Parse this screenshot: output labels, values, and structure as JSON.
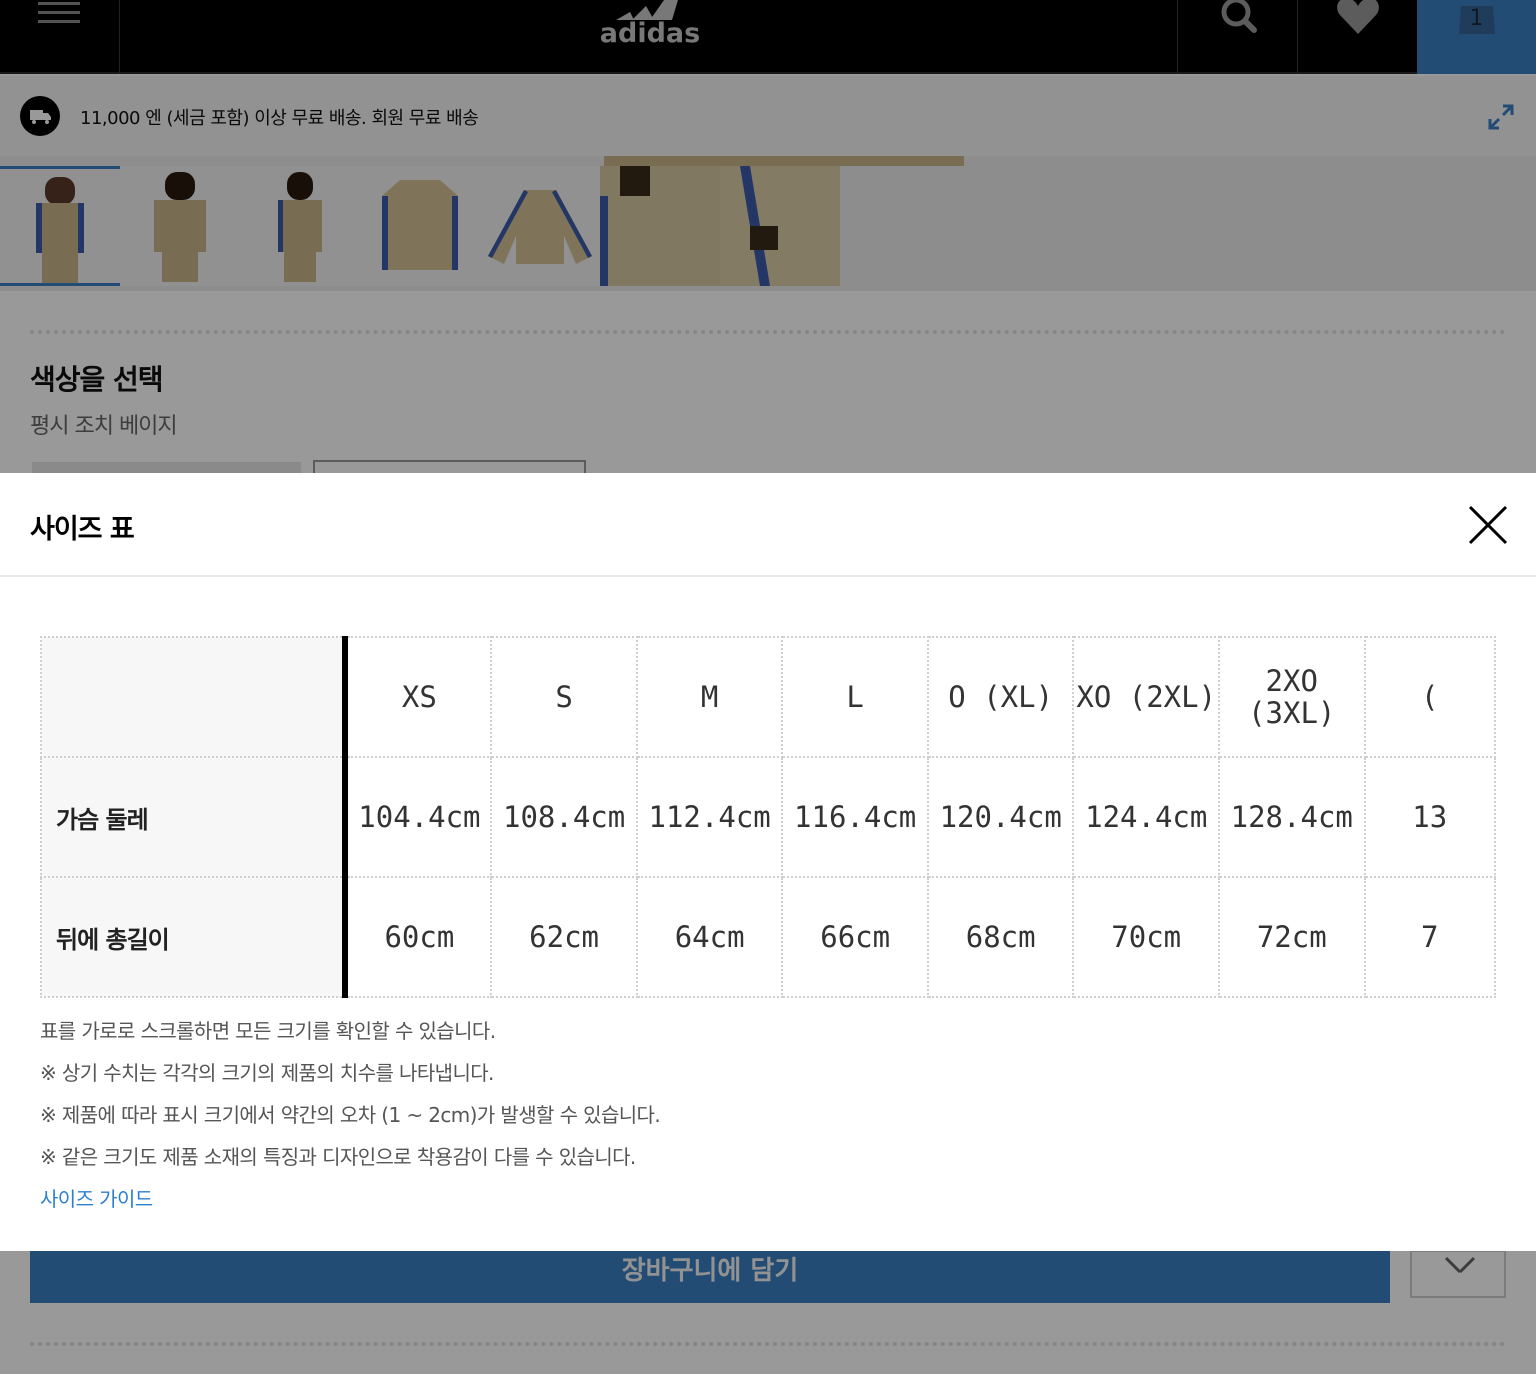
{
  "nav": {
    "brand": "adidas",
    "cart_count": "1"
  },
  "shipping": {
    "text": "11,000 엔 (세금 포함) 이상 무료 배송. 회원 무료 배송"
  },
  "product": {
    "color_title": "색상을 선택",
    "color_name": "평시 조치 베이지",
    "add_to_bag": "장바구니에 담기"
  },
  "modal": {
    "title": "사이즈 표",
    "table": {
      "headers": [
        "",
        "XS",
        "S",
        "M",
        "L",
        "O (XL)",
        "XO (2XL)",
        "2XO\n(3XL)",
        "("
      ],
      "rows": [
        {
          "label": "가슴 둘레",
          "values": [
            "104.4cm",
            "108.4cm",
            "112.4cm",
            "116.4cm",
            "120.4cm",
            "124.4cm",
            "128.4cm",
            "13"
          ]
        },
        {
          "label": "뒤에 총길이",
          "values": [
            "60cm",
            "62cm",
            "64cm",
            "66cm",
            "68cm",
            "70cm",
            "72cm",
            "7"
          ]
        }
      ]
    },
    "notes": [
      "표를 가로로 스크롤하면 모든 크기를 확인할 수 있습니다.",
      "※ 상기 수치는 각각의 크기의 제품의 치수를 나타냅니다.",
      "※ 제품에 따라 표시 크기에서 약간의 오차 (1 ~ 2cm)가 발생할 수 있습니다.",
      "※ 같은 크기도 제품 소재의 특징과 디자인으로 착용감이 다를 수 있습니다."
    ],
    "size_guide_link": "사이즈 가이드"
  },
  "colors": {
    "accent_blue": "#3a7fc2",
    "link_blue": "#2d7fd0",
    "nav_black": "#000000"
  },
  "icons": [
    "menu-icon",
    "adidas-logo",
    "search-icon",
    "heart-icon",
    "shopping-bag-icon",
    "delivery-truck-icon",
    "expand-icon",
    "close-icon"
  ]
}
